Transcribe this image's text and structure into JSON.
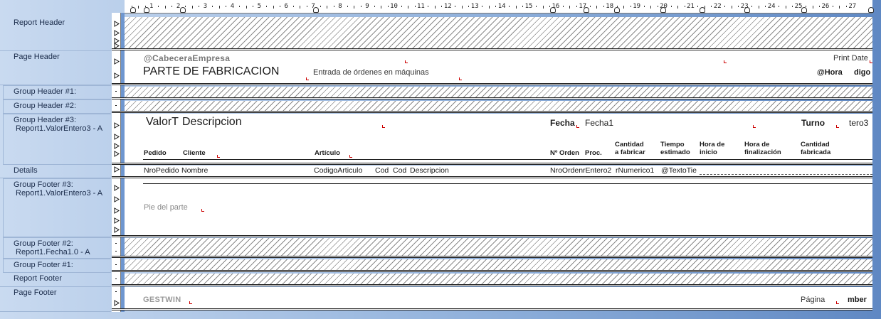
{
  "ruler": {
    "ticks": [
      "1",
      "2",
      "3",
      "4",
      "5",
      "6",
      "7",
      "8",
      "9",
      "10",
      "11",
      "12",
      "13",
      "14",
      "15",
      "16",
      "17",
      "18",
      "19",
      "20",
      "21",
      "22",
      "23",
      "24",
      "25",
      "26",
      "27"
    ]
  },
  "sections": {
    "report_header": "Report Header",
    "page_header": "Page Header",
    "group_header_1": "Group Header #1:",
    "group_header_2": "Group Header #2:",
    "group_header_3": "Group Header #3:",
    "group_header_3_sub": "Report1.ValorEntero3 - A",
    "details": "Details",
    "group_footer_3": "Group Footer #3:",
    "group_footer_3_sub": "Report1.ValorEntero3 - A",
    "group_footer_2": "Group Footer #2:",
    "group_footer_2_sub": "Report1.Fecha1.0 - A",
    "group_footer_1": "Group Footer #1:",
    "report_footer": "Report Footer",
    "page_footer": "Page Footer"
  },
  "page_header": {
    "company": "@CabeceraEmpresa",
    "title": "PARTE DE FABRICACION",
    "subtitle": "Entrada de órdenes en máquinas",
    "print_date": "Print Date",
    "hora": "@Hora",
    "codigo": "digo"
  },
  "group_header_3": {
    "valor": "ValorT",
    "descripcion": "Descripcion",
    "fecha_label": "Fecha",
    "fecha_value": "Fecha1",
    "turno_label": "Turno",
    "turno_value": "tero3",
    "col_pedido": "Pedido",
    "col_cliente": "Cliente",
    "col_articulo": "Artículo",
    "col_nro_orden": "Nº Orden",
    "col_proc": "Proc.",
    "col_cantidad_fabricar_1": "Cantidad",
    "col_cantidad_fabricar_2": "a fabricar",
    "col_tiempo_1": "Tiempo",
    "col_tiempo_2": "estimado",
    "col_hora_inicio_1": "Hora de",
    "col_hora_inicio_2": "inicio",
    "col_hora_fin_1": "Hora de",
    "col_hora_fin_2": "finalización",
    "col_cantidad_fab_1": "Cantidad",
    "col_cantidad_fab_2": "fabricada"
  },
  "details": {
    "nro_pedido": "NroPedido",
    "nombre": "Nombre",
    "codigo_articulo": "CodigoArticulo",
    "cod1": "Cod",
    "cod2": "Cod",
    "descripcion": "Descripcion",
    "nro_orden": "NroOrden",
    "entero2": "rEntero2",
    "numerico1": "rNumerico1",
    "texto_tie": "@TextoTie"
  },
  "group_footer_3": {
    "pie": "Pie del parte"
  },
  "page_footer": {
    "gestwin": "GESTWIN",
    "pagina": "Página",
    "number": "mber"
  }
}
